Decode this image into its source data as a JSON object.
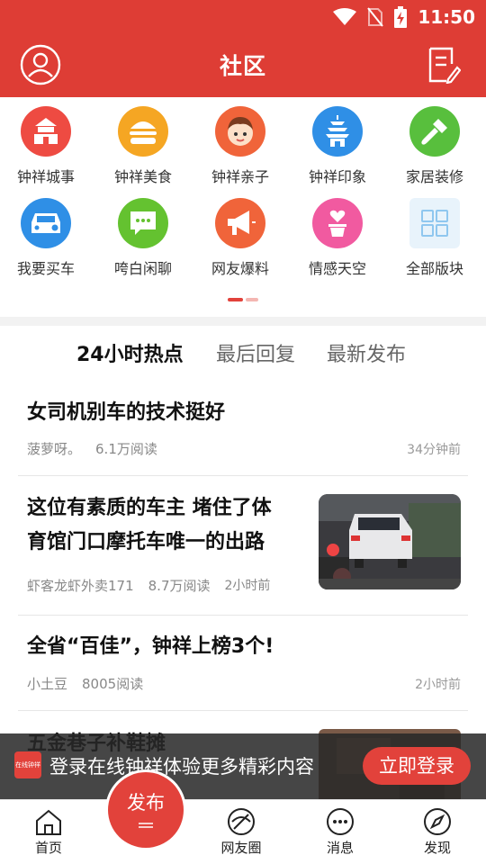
{
  "status": {
    "time": "11:50"
  },
  "header": {
    "title": "社区"
  },
  "categories": [
    {
      "label": "钟祥城事",
      "color": "#ee4b42",
      "icon": "temple-icon"
    },
    {
      "label": "钟祥美食",
      "color": "#f5a623",
      "icon": "burger-icon"
    },
    {
      "label": "钟祥亲子",
      "color": "#f0643a",
      "icon": "child-icon"
    },
    {
      "label": "钟祥印象",
      "color": "#2f8fe6",
      "icon": "pagoda-icon"
    },
    {
      "label": "家居装修",
      "color": "#58bf3d",
      "icon": "brush-icon"
    },
    {
      "label": "我要买车",
      "color": "#2f8fe6",
      "icon": "car-icon"
    },
    {
      "label": "咵白闲聊",
      "color": "#64c230",
      "icon": "chat-icon"
    },
    {
      "label": "网友爆料",
      "color": "#f0643a",
      "icon": "megaphone-icon"
    },
    {
      "label": "情感天空",
      "color": "#f15aa0",
      "icon": "heart-cup-icon"
    },
    {
      "label": "全部版块",
      "color": "#e8f3fb",
      "icon": "grid-icon"
    }
  ],
  "tabs": [
    "24小时热点",
    "最后回复",
    "最新发布"
  ],
  "articles": [
    {
      "title": "女司机别车的技术挺好",
      "author": "菠萝呀。",
      "reads": "6.1万阅读",
      "time": "34分钟前"
    },
    {
      "title": "这位有素质的车主 堵住了体育馆门口摩托车唯一的出路",
      "title_line1": "这位有素质的车主 堵住了体",
      "title_line2": "育馆门口摩托车唯一的出路",
      "author": "虾客龙虾外卖171",
      "reads": "8.7万阅读",
      "time": "2小时前"
    },
    {
      "title": "全省“百佳”，钟祥上榜3个!",
      "author": "小土豆",
      "reads": "8005阅读",
      "time": "2小时前"
    },
    {
      "title": "五金巷子补鞋摊"
    }
  ],
  "login_bar": {
    "badge": "在线钟祥",
    "text": "登录在线钟祥体验更多精彩内容",
    "button": "立即登录"
  },
  "tabbar": {
    "home": "首页",
    "publish": "发布",
    "circle": "网友圈",
    "messages": "消息",
    "discover": "发现"
  }
}
